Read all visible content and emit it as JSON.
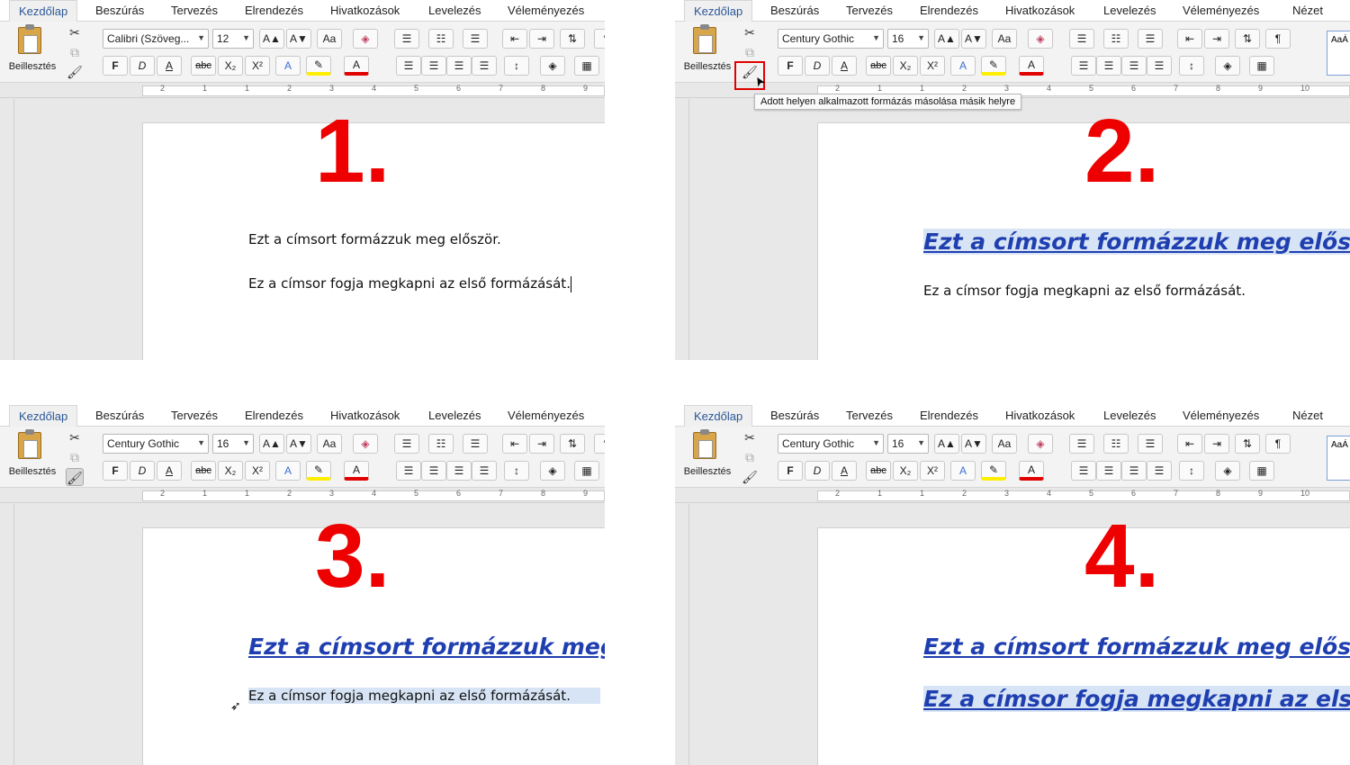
{
  "tabs": [
    "Kezdőlap",
    "Beszúrás",
    "Tervezés",
    "Elrendezés",
    "Hivatkozások",
    "Levelezés",
    "Véleményezés",
    "Nézet"
  ],
  "paste_label": "Beillesztés",
  "ribbon": {
    "bold": "F",
    "italic": "D",
    "underline": "A",
    "strike": "abc",
    "sub": "X₂",
    "sup": "X²",
    "grow": "A▲",
    "shrink": "A▼",
    "change_case": "Aa",
    "pilcrow": "¶"
  },
  "panels": [
    {
      "step": "1.",
      "font": "Calibri (Szöveg...",
      "size": "12",
      "line1": "Ezt a címsort formázzuk meg először.",
      "line2": "Ez a címsor fogja megkapni az első formázását."
    },
    {
      "step": "2.",
      "font": "Century Gothic",
      "size": "16",
      "line1": "Ezt a címsort formázzuk meg először.",
      "line2": "Ez a címsor fogja megkapni az első formázását.",
      "tooltip": "Adott helyen alkalmazott formázás másolása másik helyre",
      "styles_preview": "AaÁ"
    },
    {
      "step": "3.",
      "font": "Century Gothic",
      "size": "16",
      "line1": "Ezt a címsort formázzuk meg el",
      "line2": "Ez a címsor fogja megkapni az első formázását."
    },
    {
      "step": "4.",
      "font": "Century Gothic",
      "size": "16",
      "line1": "Ezt a címsort formázzuk meg először.",
      "line2": "Ez a címsor fogja megkapni az első fo",
      "styles_preview": "AaÁ"
    }
  ],
  "ruler_numbers": [
    "2",
    "1",
    "1",
    "2",
    "3",
    "4",
    "5",
    "6",
    "7",
    "8",
    "9",
    "10"
  ]
}
